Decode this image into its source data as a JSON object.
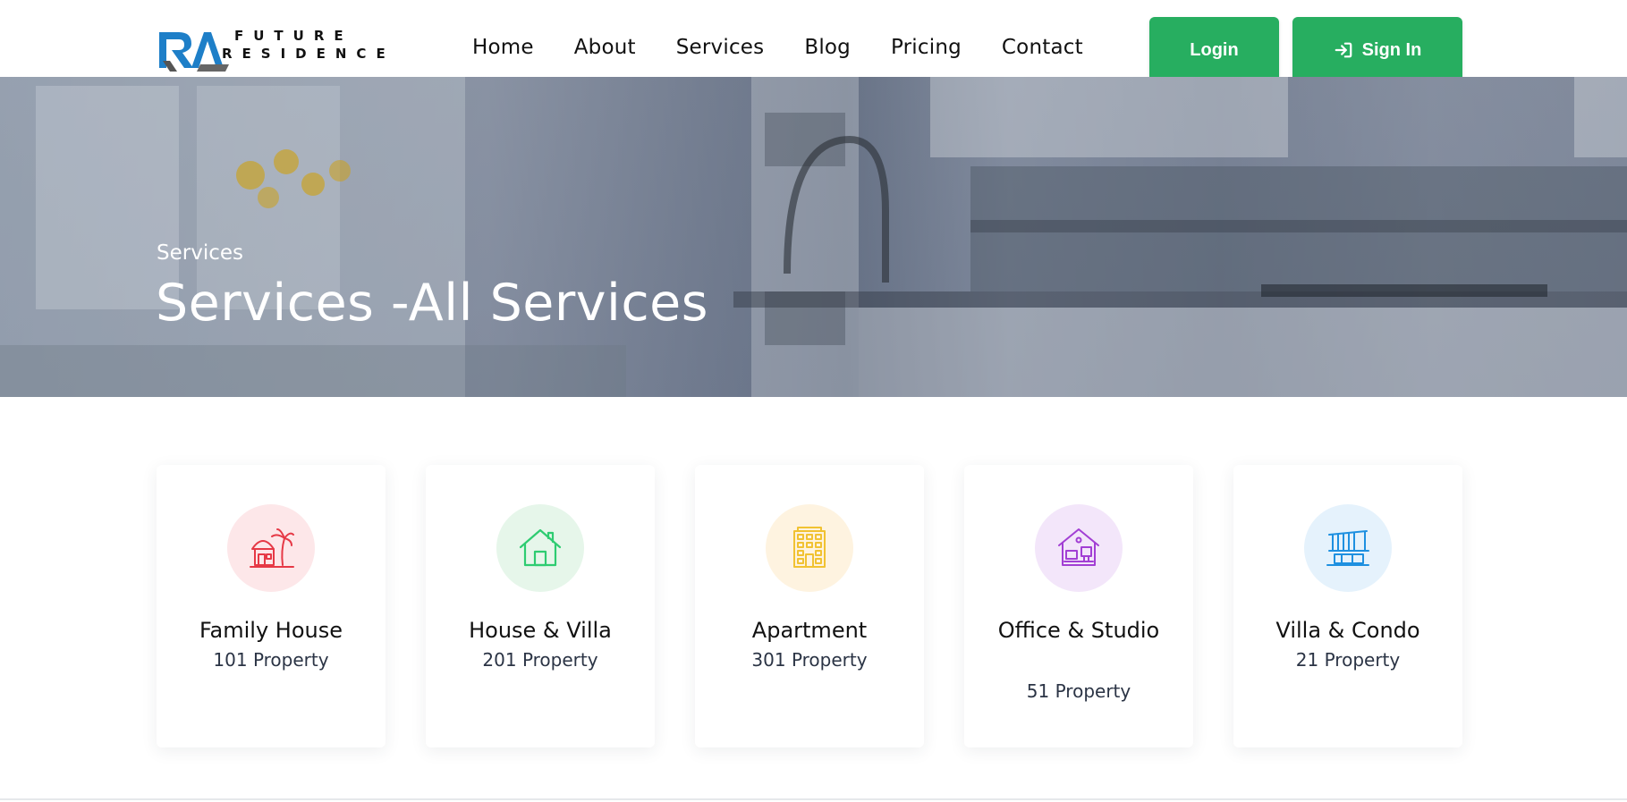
{
  "header": {
    "logo": {
      "line1": "FUTURE",
      "line2": "RESIDENCE",
      "mark_letters": "RA"
    },
    "nav": [
      {
        "label": "Home"
      },
      {
        "label": "About"
      },
      {
        "label": "Services"
      },
      {
        "label": "Blog"
      },
      {
        "label": "Pricing"
      },
      {
        "label": "Contact"
      }
    ],
    "login_label": "Login",
    "signin_label": "Sign In",
    "signin_icon": "sign-in-icon",
    "button_color": "#27ae60"
  },
  "hero": {
    "subtitle": "Services",
    "title": "Services -All Services"
  },
  "cards": [
    {
      "title": "Family House",
      "count": "101 Property",
      "icon": "beach-hut-icon",
      "color": "#e63946",
      "bg": "#fde7e9"
    },
    {
      "title": "House & Villa",
      "count": "201 Property",
      "icon": "house-icon",
      "color": "#2ecc71",
      "bg": "#e6f6ea"
    },
    {
      "title": "Apartment",
      "count": "301 Property",
      "icon": "building-icon",
      "color": "#f1c232",
      "bg": "#fef3e0"
    },
    {
      "title": "Office & Studio",
      "count": "51 Property",
      "icon": "office-icon",
      "color": "#a23fd4",
      "bg": "#f3e6fa"
    },
    {
      "title": "Villa & Condo",
      "count": "21 Property",
      "icon": "villa-icon",
      "color": "#1e90e0",
      "bg": "#e5f2fc"
    }
  ]
}
